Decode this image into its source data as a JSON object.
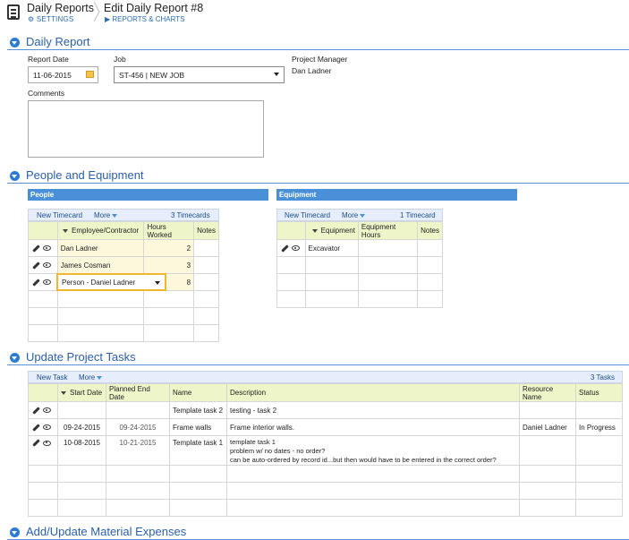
{
  "header": {
    "app_title": "Daily Reports",
    "settings_label": "SETTINGS",
    "page_title": "Edit Daily Report #8",
    "back_label": "REPORTS & CHARTS"
  },
  "daily_report": {
    "section_title": "Daily Report",
    "report_date_label": "Report Date",
    "report_date": "11-06-2015",
    "job_label": "Job",
    "job_value": "ST-456 | NEW JOB",
    "pm_label": "Project Manager",
    "pm_value": "Dan Ladner",
    "comments_label": "Comments",
    "comments_value": ""
  },
  "people_equipment": {
    "section_title": "People and Equipment",
    "people": {
      "bar_title": "People",
      "new_label": "New Timecard",
      "more_label": "More",
      "count_label": "3 Timecards",
      "columns": [
        "Employee/Contractor",
        "Hours Worked",
        "Notes"
      ],
      "rows": [
        {
          "name": "Dan Ladner",
          "hours": "2",
          "notes": ""
        },
        {
          "name": "James Cosman",
          "hours": "3",
          "notes": ""
        },
        {
          "name": "Person - Daniel Ladner",
          "hours": "8",
          "notes": ""
        }
      ]
    },
    "equipment": {
      "bar_title": "Equipment",
      "new_label": "New Timecard",
      "more_label": "More",
      "count_label": "1 Timecard",
      "columns": [
        "Equipment",
        "Equipment Hours",
        "Notes"
      ],
      "rows": [
        {
          "name": "Excavator",
          "hours": "",
          "notes": ""
        }
      ]
    }
  },
  "tasks": {
    "section_title": "Update Project Tasks",
    "new_label": "New Task",
    "more_label": "More",
    "count_label": "3 Tasks",
    "columns": [
      "Start Date",
      "Planned End Date",
      "Name",
      "Description",
      "Resource Name",
      "Status"
    ],
    "rows": [
      {
        "start": "",
        "end": "",
        "name": "Template task 2",
        "desc": [
          "testing - task 2"
        ],
        "resource": "",
        "status": ""
      },
      {
        "start": "09-24-2015",
        "end": "09-24-2015",
        "name": "Frame walls",
        "desc": [
          "Frame interior walls."
        ],
        "resource": "Daniel Ladner",
        "status": "In Progress"
      },
      {
        "start": "10-08-2015",
        "end": "10-21-2015",
        "name": "Template task 1",
        "desc": [
          "template task 1",
          "problem w/ no dates - no order?",
          "can be auto-ordered by record id...but then would have to be entered in the correct order?"
        ],
        "resource": "",
        "status": ""
      }
    ]
  },
  "materials": {
    "section_title": "Add/Update Material Expenses"
  }
}
